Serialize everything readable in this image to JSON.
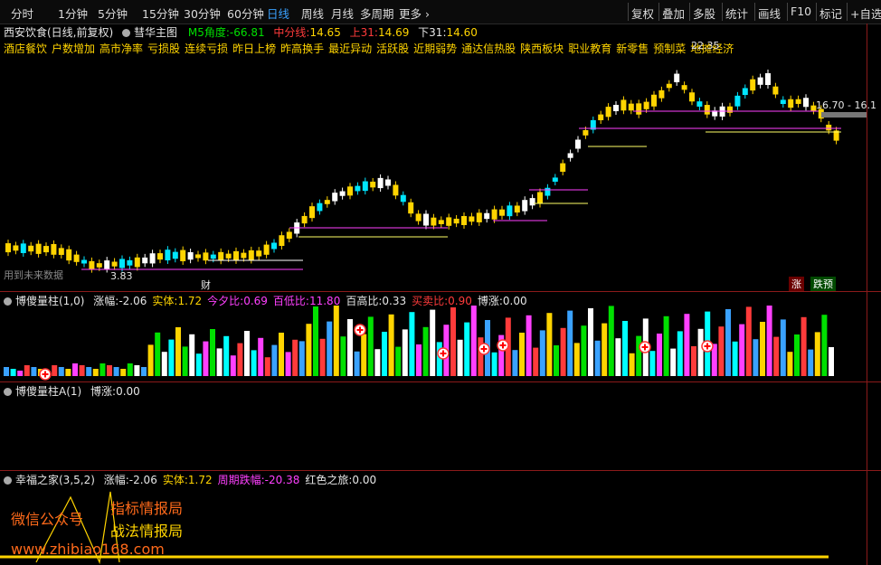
{
  "toolbar": {
    "periods": [
      "分时",
      "1分钟",
      "5分钟",
      "15分钟",
      "30分钟",
      "60分钟",
      "日线",
      "周线",
      "月线",
      "多周期",
      "更多"
    ],
    "active_period": "日线",
    "right_buttons": [
      "复权",
      "叠加",
      "多股",
      "统计",
      "画线",
      "F10",
      "标记",
      "+自选"
    ]
  },
  "main_chart": {
    "stock_title": "西安饮食(日线,前复权)",
    "indicator_name": "彗华主图",
    "m5_angle_label": "M5角度:",
    "m5_angle_value": "-66.81",
    "mid_line_label": "中分线:",
    "mid_line_value": "14.65",
    "upper31_label": "上31:",
    "upper31_value": "14.69",
    "lower31_label": "下31:",
    "lower31_value": "14.60",
    "concepts": [
      "酒店餐饮",
      "户数增加",
      "高市净率",
      "亏损股",
      "连续亏损",
      "昨日上榜",
      "昨高换手",
      "最近异动",
      "活跃股",
      "近期弱势",
      "通达信热股",
      "陕西板块",
      "职业教育",
      "新零售",
      "预制菜",
      "地摊经济"
    ],
    "peak_label": "22.35",
    "low_label": "3.83",
    "range_label": "16.70 - 16.1",
    "future_data_label": "用到未来数据",
    "cai_marker": "财",
    "zhang_badge": "涨",
    "yuce_badge": "跌预"
  },
  "ind1": {
    "name": "博傻量柱(1,0)",
    "items": [
      {
        "label": "涨幅:",
        "value": "-2.06",
        "color": "#e6e6e6"
      },
      {
        "label": "实体:",
        "value": "1.72",
        "color": "#ffd400"
      },
      {
        "label": "今夕比:",
        "value": "0.69",
        "color": "#ff40ff"
      },
      {
        "label": "百低比:",
        "value": "11.80",
        "color": "#ff40ff"
      },
      {
        "label": "百高比:",
        "value": "0.33",
        "color": "#e6e6e6"
      },
      {
        "label": "买卖比:",
        "value": "0.90",
        "color": "#ff3b3b"
      },
      {
        "label": "博涨:",
        "value": "0.00",
        "color": "#e6e6e6"
      }
    ]
  },
  "ind2": {
    "name": "博傻量柱A(1)",
    "items": [
      {
        "label": "博涨:",
        "value": "0.00",
        "color": "#e6e6e6"
      }
    ]
  },
  "ind3": {
    "name": "幸福之家(3,5,2)",
    "items": [
      {
        "label": "涨幅:",
        "value": "-2.06",
        "color": "#e6e6e6"
      },
      {
        "label": "实体:",
        "value": "1.72",
        "color": "#ffd400"
      },
      {
        "label": "周期跌幅:",
        "value": "-20.38",
        "color": "#ff40ff"
      },
      {
        "label": "红色之旅:",
        "value": "0.00",
        "color": "#e6e6e6"
      }
    ]
  },
  "watermark": {
    "wechat_label": "微信公众号",
    "line1": "指标情报局",
    "line2": "战法情报局",
    "url": "www.zhibiao168.com"
  },
  "colors": {
    "up": "#ff3b3b",
    "down": "#00ffff",
    "yellow": "#ffd400",
    "magenta": "#ff40ff",
    "frame": "#8b1a1a"
  }
}
